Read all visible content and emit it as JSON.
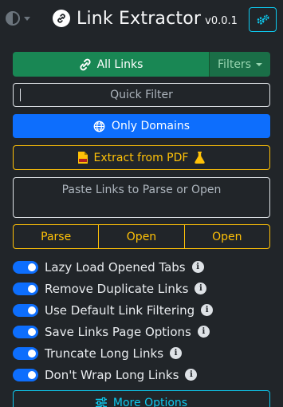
{
  "header": {
    "title": "Link Extractor",
    "version": "v0.0.1"
  },
  "actions": {
    "all_links_label": "All Links",
    "filters_label": "Filters",
    "quick_filter_placeholder": "Quick Filter",
    "only_domains_label": "Only Domains",
    "extract_pdf_label": "Extract from PDF",
    "parse_placeholder": "Paste Links to Parse or Open",
    "parse_button": "Parse",
    "open_button_1": "Open",
    "open_button_2": "Open",
    "more_options_label": "More Options"
  },
  "options": [
    {
      "label": "Lazy Load Opened Tabs",
      "enabled": true
    },
    {
      "label": "Remove Duplicate Links",
      "enabled": true
    },
    {
      "label": "Use Default Link Filtering",
      "enabled": true
    },
    {
      "label": "Save Links Page Options",
      "enabled": true
    },
    {
      "label": "Truncate Long Links",
      "enabled": true
    },
    {
      "label": "Don't Wrap Long Links",
      "enabled": true
    }
  ],
  "colors": {
    "background": "#212529",
    "success": "#198754",
    "primary": "#0d6efd",
    "warning": "#ffc107",
    "info": "#0dcaf0"
  }
}
